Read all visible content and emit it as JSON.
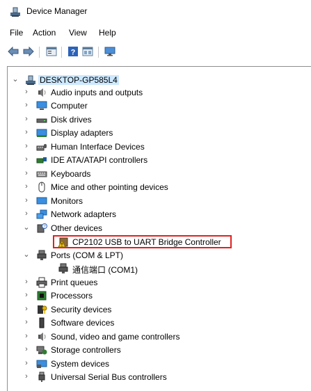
{
  "window": {
    "title": "Device Manager"
  },
  "menu": {
    "items": [
      "File",
      "Action",
      "View",
      "Help"
    ]
  },
  "toolbar": {
    "buttons": [
      "back-arrow-icon",
      "forward-arrow-icon",
      "properties-icon",
      "help-icon",
      "view-icon",
      "monitor-icon"
    ]
  },
  "tree": {
    "root": "DESKTOP-GP585L4",
    "items": [
      "Audio inputs and outputs",
      "Computer",
      "Disk drives",
      "Display adapters",
      "Human Interface Devices",
      "IDE ATA/ATAPI controllers",
      "Keyboards",
      "Mice and other pointing devices",
      "Monitors",
      "Network adapters",
      "Other devices",
      "CP2102 USB to UART Bridge Controller",
      "Ports (COM & LPT)",
      "通信端口 (COM1)",
      "Print queues",
      "Processors",
      "Security devices",
      "Software devices",
      "Sound, video and game controllers",
      "Storage controllers",
      "System devices",
      "Universal Serial Bus controllers"
    ]
  },
  "colors": {
    "highlight_border": "#e02020",
    "selection": "#cce8ff"
  }
}
